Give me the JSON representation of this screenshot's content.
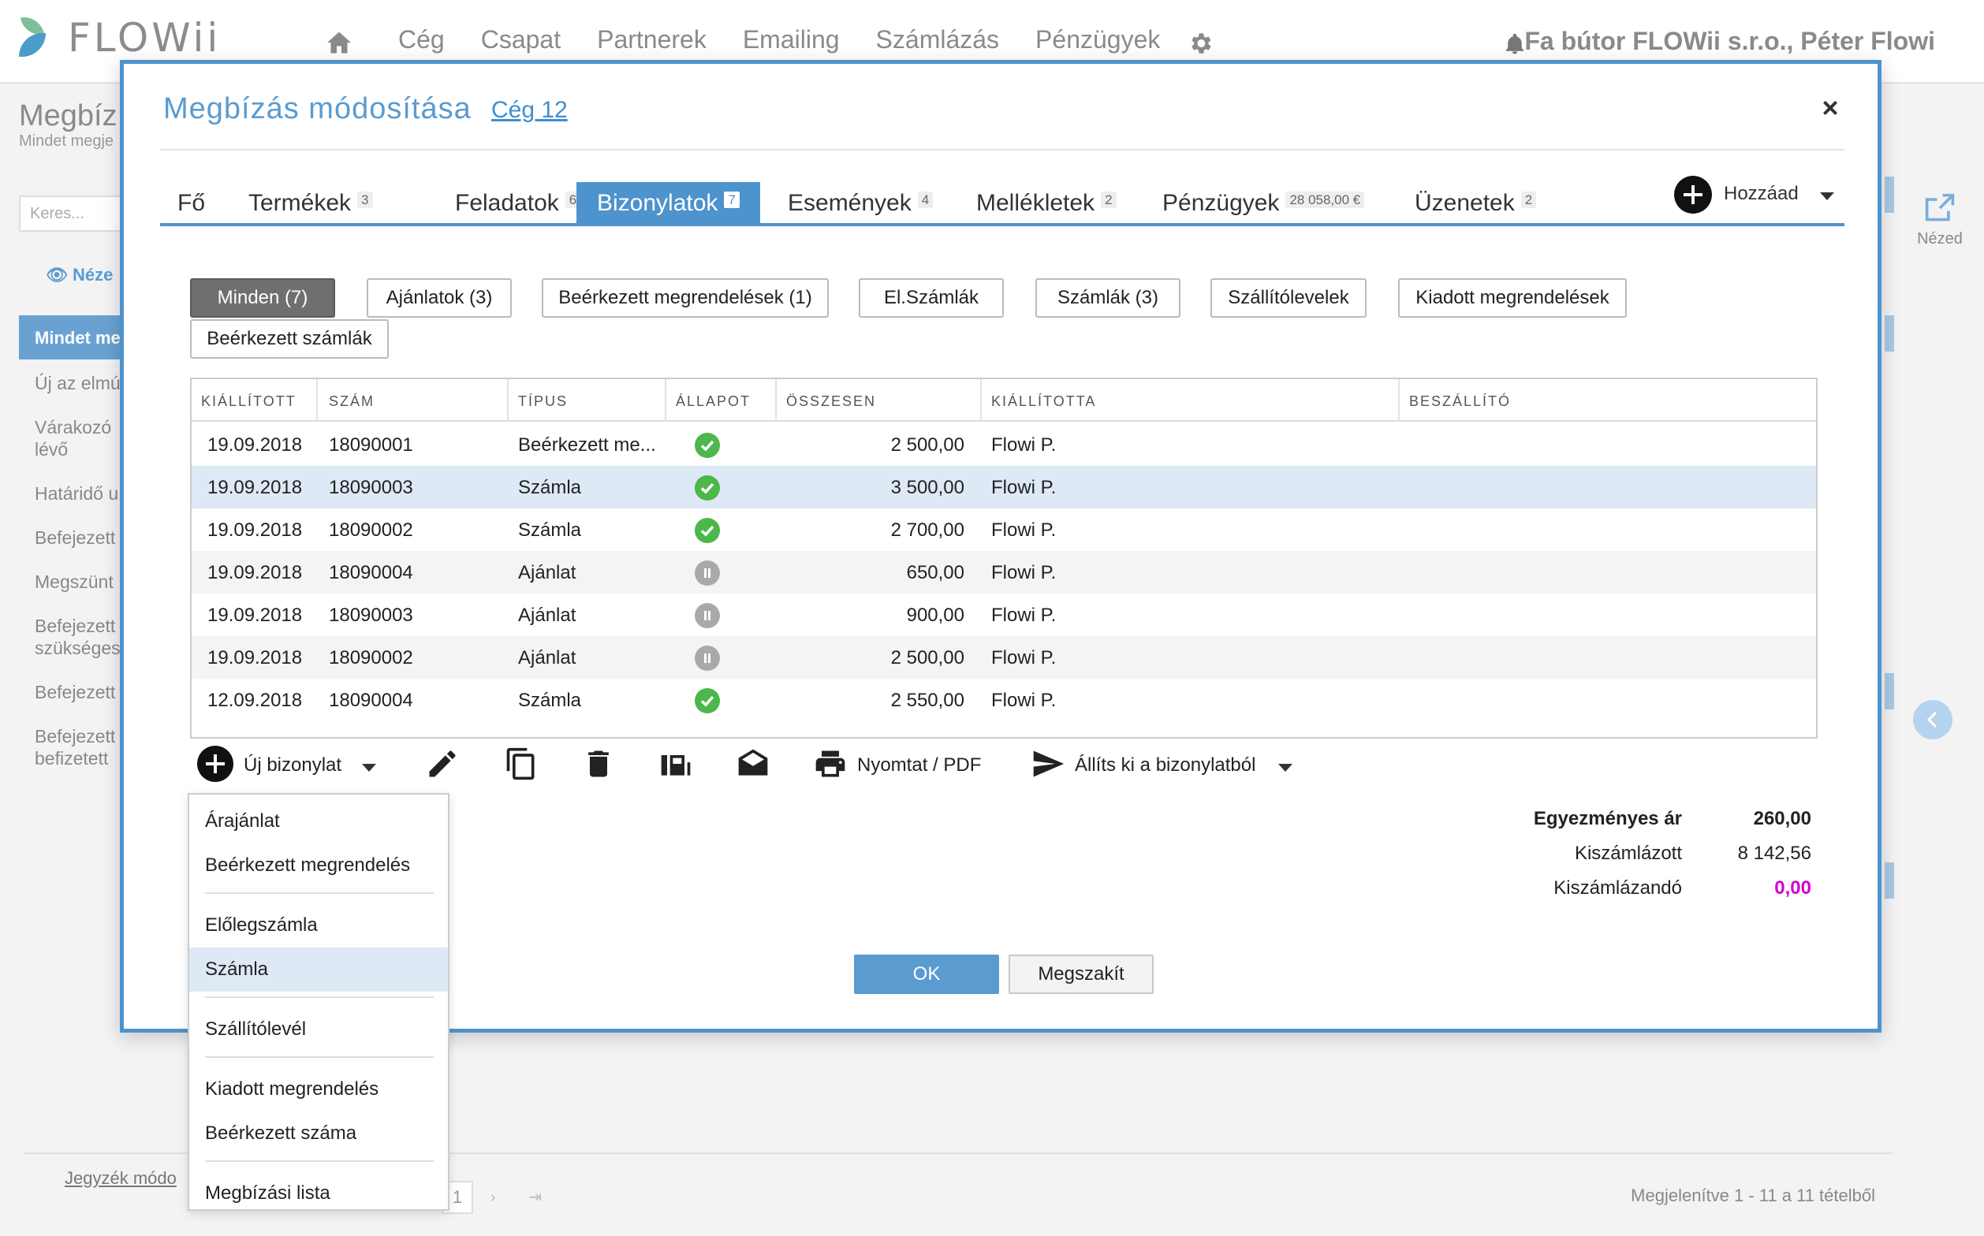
{
  "nav": {
    "logo_text": "FLOWii",
    "items": [
      "Cég",
      "Csapat",
      "Partnerek",
      "Emailing",
      "Számlázás",
      "Pénzügyek"
    ],
    "user": "Fa bútor FLOWii s.r.o., Péter Flowi"
  },
  "background": {
    "title": "Megbíz",
    "subtitle": "Mindet megje",
    "search_placeholder": "Keres...",
    "view_label": "Néze",
    "active_item": "Mindet me",
    "items": [
      "Új az elmú",
      "Várakozó\nlévő",
      "Határidő u",
      "Befejezett",
      "Megszünt",
      "Befejezett\nszükséges",
      "Befejezett",
      "Befejezett\nbefizetett"
    ],
    "footer_link": "Jegyzék módo",
    "pager_page": "1",
    "footer_info": "Megjelenítve 1 - 11 a 11 tételből",
    "right_label": "Nézed"
  },
  "modal": {
    "title": "Megbízás módosítása",
    "company_link": "Cég 12",
    "close": "×",
    "tabs": [
      {
        "label": "Fő",
        "count": ""
      },
      {
        "label": "Termékek",
        "count": "3"
      },
      {
        "label": "Feladatok",
        "count": "6"
      },
      {
        "label": "Bizonylatok",
        "count": "7"
      },
      {
        "label": "Események",
        "count": "4"
      },
      {
        "label": "Mellékletek",
        "count": "2"
      },
      {
        "label": "Pénzügyek",
        "count": "28 058,00 €"
      },
      {
        "label": "Üzenetek",
        "count": "2"
      }
    ],
    "add_label": "Hozzáad",
    "filters": [
      "Minden (7)",
      "Ajánlatok (3)",
      "Beérkezett megrendelések (1)",
      "El.Számlák",
      "Számlák (3)",
      "Szállítólevelek",
      "Kiadott megrendelések",
      "Beérkezett számlák"
    ],
    "table": {
      "headers": [
        "KIÁLLÍTOTT",
        "SZÁM",
        "TÍPUS",
        "ÁLLAPOT",
        "ÖSSZESEN",
        "KIÁLLÍTOTTA",
        "BESZÁLLÍTÓ"
      ],
      "rows": [
        {
          "date": "19.09.2018",
          "num": "18090001",
          "type": "Beérkezett me...",
          "status": "ok",
          "total": "2 500,00",
          "by": "Flowi P.",
          "supplier": ""
        },
        {
          "date": "19.09.2018",
          "num": "18090003",
          "type": "Számla",
          "status": "ok",
          "total": "3 500,00",
          "by": "Flowi P.",
          "supplier": ""
        },
        {
          "date": "19.09.2018",
          "num": "18090002",
          "type": "Számla",
          "status": "ok",
          "total": "2 700,00",
          "by": "Flowi P.",
          "supplier": ""
        },
        {
          "date": "19.09.2018",
          "num": "18090004",
          "type": "Ajánlat",
          "status": "pause",
          "total": "650,00",
          "by": "Flowi P.",
          "supplier": ""
        },
        {
          "date": "19.09.2018",
          "num": "18090003",
          "type": "Ajánlat",
          "status": "pause",
          "total": "900,00",
          "by": "Flowi P.",
          "supplier": ""
        },
        {
          "date": "19.09.2018",
          "num": "18090002",
          "type": "Ajánlat",
          "status": "pause",
          "total": "2 500,00",
          "by": "Flowi P.",
          "supplier": ""
        },
        {
          "date": "12.09.2018",
          "num": "18090004",
          "type": "Számla",
          "status": "ok",
          "total": "2 550,00",
          "by": "Flowi P.",
          "supplier": ""
        }
      ]
    },
    "toolbar": {
      "new_doc": "Új bizonylat",
      "print": "Nyomtat / PDF",
      "issue_from": "Állíts ki a bizonylatból"
    },
    "totals": [
      {
        "label": "Egyezményes ár",
        "value": "260,00"
      },
      {
        "label": "Kiszámlázott",
        "value": "8 142,56"
      },
      {
        "label": "Kiszámlázandó",
        "value": "0,00"
      }
    ],
    "ok": "OK",
    "cancel": "Megszakít"
  },
  "dropdown": {
    "items": [
      "Árajánlat",
      "Beérkezett megrendelés",
      "Előlegszámla",
      "Számla",
      "Szállítólevél",
      "Kiadott megrendelés",
      "Beérkezett száma",
      "Megbízási lista"
    ],
    "selected": "Számla"
  },
  "colors": {
    "accent": "#4d93cd",
    "ok_status": "#4cb74a",
    "pending_status": "#a9a9a9",
    "highlight_value": "#d100d1",
    "selected_row": "#dde9f4"
  }
}
